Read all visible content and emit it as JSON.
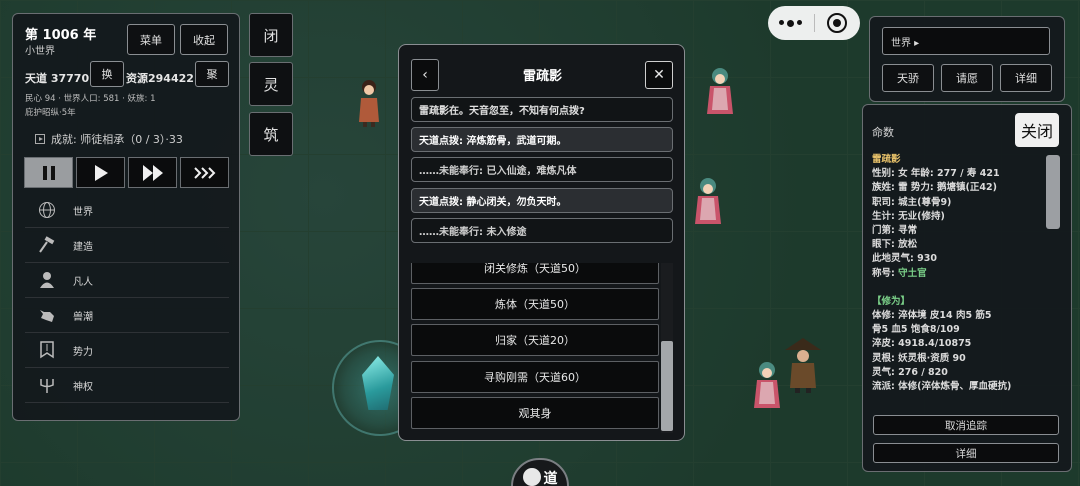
{
  "left": {
    "year": "第 1006 年",
    "world_kind": "小世界",
    "menu_label": "菜单",
    "collapse_label": "收起",
    "tiandao": "天道 37770",
    "swap_label": "换",
    "resource": "资源294422",
    "gather_label": "聚",
    "line1": "民心 94 · 世界人口: 581 · 妖族: 1",
    "line2": "庇护昭纵·5年",
    "achievement": "成就: 师徒相承（0 / 3）·33",
    "menu": [
      {
        "label": "世界",
        "icon": "globe-icon"
      },
      {
        "label": "建造",
        "icon": "hammer-icon"
      },
      {
        "label": "凡人",
        "icon": "person-icon"
      },
      {
        "label": "兽潮",
        "icon": "wolf-icon"
      },
      {
        "label": "势力",
        "icon": "banner-icon"
      },
      {
        "label": "神权",
        "icon": "trident-icon"
      }
    ]
  },
  "vertical_buttons": [
    "闭",
    "灵",
    "筑"
  ],
  "right_top": {
    "world_select": "世界 ▸",
    "buttons": [
      "天骄",
      "请愿",
      "详细"
    ]
  },
  "info": {
    "title": "命数",
    "close_label": "关闭",
    "name": "雷疏影",
    "lines": [
      "性别: 女 年龄: 277 / 寿 421",
      "族姓: 雷 势力: 鹅塘镇(正42)",
      "职司: 城主(尊骨9)",
      "生计: 无业(修持)",
      "门第: 寻常",
      "眼下: 放松",
      "此地灵气: 930"
    ],
    "title_label": "称号:",
    "title_value": "守土官",
    "section": "【修为】",
    "lines2": [
      "体修: 淬体境 皮14 肉5 筋5",
      "骨5 血5 饱食8/109",
      "淬皮: 4918.4/10875",
      "灵根: 妖灵根·资质 90",
      "灵气: 276 / 820",
      "流派: 体修(淬体炼骨、厚血硬抗)"
    ],
    "cancel_track": "取消追踪",
    "detail": "详细"
  },
  "dialog": {
    "back": "‹",
    "title": "雷疏影",
    "close": "✕",
    "messages": [
      "雷疏影在。天音忽至，不知有何点拨?",
      "天道点拨: 淬炼筋骨，武道可期。",
      "……未能奉行: 已入仙途，难炼凡体",
      "天道点拨: 静心闭关，勿负天时。",
      "……未能奉行: 未入修途"
    ],
    "options": [
      "闭关修炼（天道50）",
      "炼体（天道50）",
      "归家（天道20）",
      "寻购刚需（天道60）",
      "观其身"
    ]
  },
  "bottom_badge": "道"
}
